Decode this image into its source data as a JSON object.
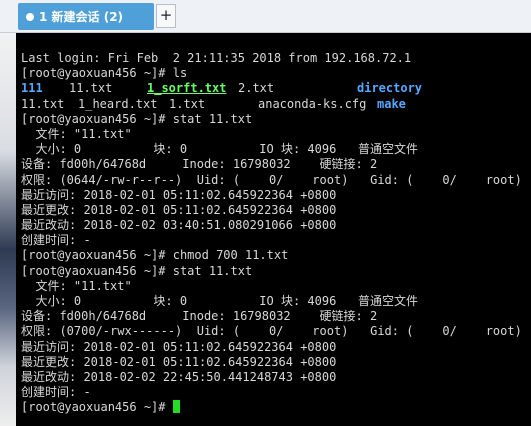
{
  "tab": {
    "label": "1 新建会话 (2)",
    "add_label": "+"
  },
  "colors": {
    "directory": "#56a8ff",
    "executable": "#66ff66",
    "tab_active": "#4fa0d8",
    "cursor": "#22dd22"
  },
  "terminal": {
    "login": "Last login: Fri Feb  2 21:11:35 2018 from 192.168.72.1",
    "prompt1": "[root@yaoxuan456 ~]# ls",
    "ls_row1": [
      "111",
      "11.txt",
      "1_sorft.txt",
      "2.txt",
      "directory"
    ],
    "ls_row2": [
      "11.txt",
      "1_heard.txt",
      "1.txt",
      "anaconda-ks.cfg",
      "make"
    ],
    "stat1": [
      "[root@yaoxuan456 ~]# stat 11.txt",
      "  文件: \"11.txt\"",
      "  大小: 0          块: 0          IO 块: 4096   普通空文件",
      "设备: fd00h/64768d     Inode: 16798032    硬链接: 2",
      "权限: (0644/-rw-r--r--)  Uid: (    0/    root)   Gid: (    0/    root)",
      "最近访问: 2018-02-01 05:11:02.645922364 +0800",
      "最近更改: 2018-02-01 05:11:02.645922364 +0800",
      "最近改动: 2018-02-02 03:40:51.080291066 +0800",
      "创建时间: -"
    ],
    "chmod": "[root@yaoxuan456 ~]# chmod 700 11.txt",
    "stat2": [
      "[root@yaoxuan456 ~]# stat 11.txt",
      "  文件: \"11.txt\"",
      "  大小: 0          块: 0          IO 块: 4096   普通空文件",
      "设备: fd00h/64768d     Inode: 16798032    硬链接: 2",
      "权限: (0700/-rwx------)  Uid: (    0/    root)   Gid: (    0/    root)",
      "最近访问: 2018-02-01 05:11:02.645922364 +0800",
      "最近更改: 2018-02-01 05:11:02.645922364 +0800",
      "最近改动: 2018-02-02 22:45:50.441248743 +0800",
      "创建时间: -"
    ],
    "final_prompt": "[root@yaoxuan456 ~]# "
  }
}
